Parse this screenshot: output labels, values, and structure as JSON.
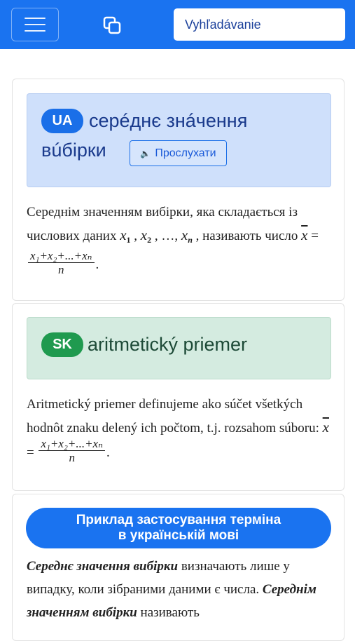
{
  "header": {
    "search_placeholder": "Vyhľadávanie"
  },
  "ua_card": {
    "badge": "UA",
    "term_line1": "серéднє знáчення",
    "term_line2": "вúбірки",
    "listen_label": "Прослухати",
    "def_part1": "Середнім значенням вибірки, яка складається із числових даних ",
    "x1": "x",
    "sub1": "1",
    "sep1": " , ",
    "x2": "x",
    "sub2": "2",
    "dots": " , …, ",
    "xn": "x",
    "subn": "n",
    "def_part2": " , називають число ",
    "xbar": "x",
    "eq": " = ",
    "numerator": "x₁+x₂+...+xₙ",
    "denominator": "n",
    "end": "."
  },
  "sk_card": {
    "badge": "SK",
    "term": "aritmetický priemer",
    "def_part1": "Aritmetický priemer definujeme ako súčet všetkých hodnôt znaku delený ich počtom, t.j. rozsahom súboru: ",
    "xbar": "x",
    "eq": " = ",
    "numerator": "x₁+x₂+...+xₙ",
    "denominator": "n",
    "end": "."
  },
  "example_card": {
    "button_line1": "Приклад застосування терміна",
    "button_line2": "в українській мові",
    "bold1": "Середнє значення вибірки",
    "text1": " визначають лише у випадку, коли зібраними даними є числа. ",
    "bold2": "Середнім значенням вибірки",
    "text2": " називають"
  }
}
